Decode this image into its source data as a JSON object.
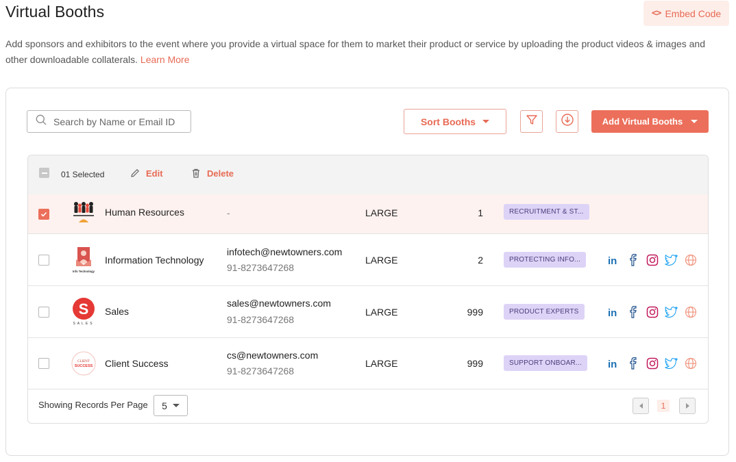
{
  "header": {
    "title": "Virtual Booths",
    "embed_label": "Embed Code",
    "description": "Add sponsors and exhibitors to the event where you provide a virtual space for them to market their product or service by uploading the product videos & images and other downloadable collaterals.",
    "learn_more": "Learn More"
  },
  "toolbar": {
    "search_placeholder": "Search by Name or Email ID",
    "sort_label": "Sort Booths",
    "add_label": "Add Virtual Booths",
    "accent": "#ec6f5b"
  },
  "selection": {
    "count_label": "01 Selected",
    "edit_label": "Edit",
    "delete_label": "Delete"
  },
  "rows": [
    {
      "name": "Human Resources",
      "email": "",
      "phone": "",
      "placeholder": "-",
      "size": "LARGE",
      "count": "1",
      "tag": "RECRUITMENT & ST...",
      "checked": true,
      "logo": "hr-logo",
      "socials": []
    },
    {
      "name": "Information Technology",
      "email": "infotech@newtowners.com",
      "phone": "91-8273647268",
      "size": "LARGE",
      "count": "2",
      "tag": "PROTECTING INFO...",
      "checked": false,
      "logo": "it-logo",
      "logo_text": "Info Technology",
      "socials": [
        "linkedin-icon",
        "facebook-icon",
        "instagram-icon",
        "twitter-icon",
        "globe-icon"
      ]
    },
    {
      "name": "Sales",
      "email": "sales@newtowners.com",
      "phone": "91-8273647268",
      "size": "LARGE",
      "count": "999",
      "tag": "PRODUCT EXPERTS",
      "checked": false,
      "logo": "sales-logo",
      "logo_text": "S",
      "logo_subtext": "SALES",
      "socials": [
        "linkedin-icon",
        "facebook-icon",
        "instagram-icon",
        "twitter-icon",
        "globe-icon"
      ]
    },
    {
      "name": "Client Success",
      "email": "cs@newtowners.com",
      "phone": "91-8273647268",
      "size": "LARGE",
      "count": "999",
      "tag": "SUPPORT ONBOAR...",
      "checked": false,
      "logo": "client-success-logo",
      "logo_text": "CLIENT",
      "logo_subtext": "SUCCESS",
      "socials": [
        "linkedin-icon",
        "facebook-icon",
        "instagram-icon",
        "twitter-icon",
        "globe-icon"
      ]
    }
  ],
  "footer": {
    "records_label": "Showing Records Per Page",
    "per_page": "5",
    "current_page": "1"
  }
}
